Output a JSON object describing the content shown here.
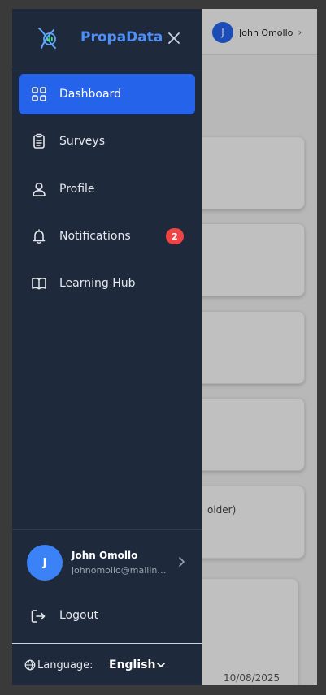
{
  "app": {
    "brand": "PropaData"
  },
  "header": {
    "avatar_initial": "J",
    "user_name": "John Omollo"
  },
  "background": {
    "card_text": "older)",
    "date": "10/08/2025"
  },
  "nav": {
    "items": [
      {
        "label": "Dashboard",
        "icon": "grid-icon",
        "active": true
      },
      {
        "label": "Surveys",
        "icon": "clipboard-icon"
      },
      {
        "label": "Profile",
        "icon": "user-icon"
      },
      {
        "label": "Notifications",
        "icon": "bell-icon",
        "badge": "2"
      },
      {
        "label": "Learning Hub",
        "icon": "book-icon"
      }
    ]
  },
  "user": {
    "initial": "J",
    "name": "John Omollo",
    "email": "johnomollo@mailinator.com"
  },
  "logout": {
    "label": "Logout"
  },
  "language": {
    "label": "Language:",
    "value": "English"
  },
  "colors": {
    "drawer_bg": "#1e293b",
    "accent": "#2563eb",
    "brand": "#4f8ff7",
    "badge": "#ef4444"
  }
}
